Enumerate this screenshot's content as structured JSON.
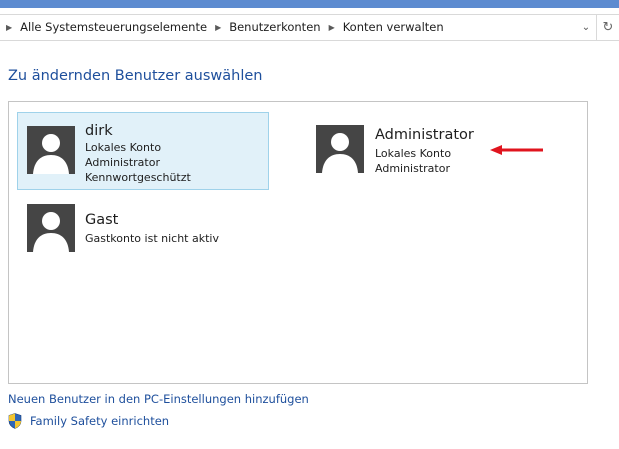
{
  "breadcrumb": {
    "items": [
      "Alle Systemsteuerungselemente",
      "Benutzerkonten",
      "Konten verwalten"
    ]
  },
  "heading": "Zu ändernden Benutzer auswählen",
  "accounts": [
    {
      "name": "dirk",
      "lines": [
        "Lokales Konto",
        "Administrator",
        "Kennwortgeschützt"
      ],
      "selected": true
    },
    {
      "name": "Administrator",
      "lines": [
        "Lokales Konto",
        "Administrator"
      ],
      "selected": false
    },
    {
      "name": "Gast",
      "lines": [
        "Gastkonto ist nicht aktiv"
      ],
      "selected": false
    }
  ],
  "links": {
    "add_user": "Neuen Benutzer in den PC-Einstellungen hinzufügen",
    "family_safety": "Family Safety einrichten"
  },
  "colors": {
    "link": "#1e4f9c",
    "selection_fill": "#e1f1f9",
    "selection_border": "#9fd2ea",
    "annotation_arrow": "#e0141e",
    "avatar_bg": "#454545"
  },
  "icons": {
    "breadcrumb_separator": "triangle-right-icon",
    "address_dropdown": "chevron-down-icon",
    "refresh": "refresh-icon",
    "avatar": "user-silhouette-icon",
    "family_safety": "uac-shield-icon"
  }
}
